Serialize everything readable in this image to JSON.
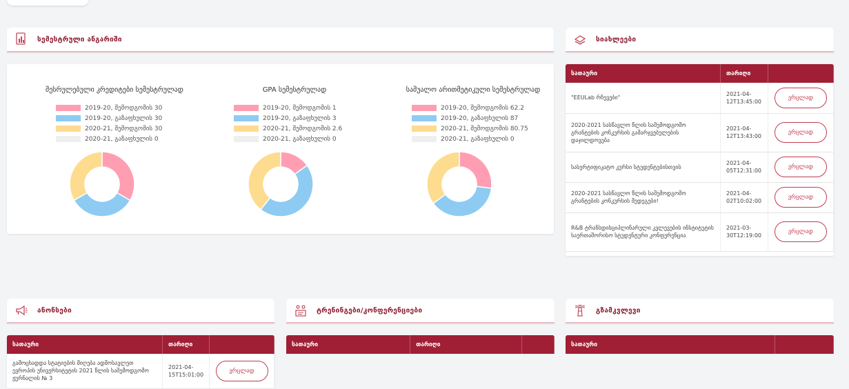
{
  "semester_report": {
    "title": "სემესტრული ანგარიში",
    "charts": [
      {
        "title": "შესრულებული კრედიტები სემესტრულად",
        "legend": [
          "2019-20, შემოდგომის 30",
          "2019-20, გაზაფხულის 30",
          "2020-21, შემოდგომის 30",
          "2020-21, გაზაფხულის 0"
        ]
      },
      {
        "title": "GPA სემესტრულად",
        "legend": [
          "2019-20, შემოდგომის 1",
          "2019-20, გაზაფხულის 3",
          "2020-21, შემოდგომის 2.6",
          "2020-21, გაზაფხულის 0"
        ]
      },
      {
        "title": "საშუალო არითმეტიკული სემესტრულად",
        "legend": [
          "2019-20, შემოდგომის 62.2",
          "2019-20, გაზაფხულის 87",
          "2020-21, შემოდგომის 80.75",
          "2020-21, გაზაფხულის 0"
        ]
      }
    ]
  },
  "chart_data": [
    {
      "type": "pie",
      "title": "შესრულებული კრედიტები სემესტრულად",
      "categories": [
        "2019-20, შემოდგომის",
        "2019-20, გაზაფხულის",
        "2020-21, შემოდგომის",
        "2020-21, გაზაფხულის"
      ],
      "values": [
        30,
        30,
        30,
        0
      ],
      "colors": [
        "#ff9eb2",
        "#8ecbf2",
        "#fddc8f",
        "#efefef"
      ],
      "legend_position": "top"
    },
    {
      "type": "pie",
      "title": "GPA სემესტრულად",
      "categories": [
        "2019-20, შემოდგომის",
        "2019-20, გაზაფხულის",
        "2020-21, შემოდგომის",
        "2020-21, გაზაფხულის"
      ],
      "values": [
        1,
        3,
        2.6,
        0
      ],
      "colors": [
        "#ff9eb2",
        "#8ecbf2",
        "#fddc8f",
        "#efefef"
      ],
      "legend_position": "top"
    },
    {
      "type": "pie",
      "title": "საშუალო არითმეტიკული სემესტრულად",
      "categories": [
        "2019-20, შემოდგომის",
        "2019-20, გაზაფხულის",
        "2020-21, შემოდგომის",
        "2020-21, გაზაფხულის"
      ],
      "values": [
        62.2,
        87,
        80.75,
        0
      ],
      "colors": [
        "#ff9eb2",
        "#8ecbf2",
        "#fddc8f",
        "#efefef"
      ],
      "legend_position": "top"
    }
  ],
  "news": {
    "title": "სიახლეები",
    "col_title": "სათაური",
    "col_date": "თარიღი",
    "button_label": "ვრცლად",
    "rows": [
      {
        "title": "\"EEULab რჩევები\"",
        "date": "2021-04-12T13:45:00"
      },
      {
        "title": "2020-2021 სასწავლო წლის საშემოდგომო გრანტების კონკურსის გამარჯვებულების დაჯილდოვება",
        "date": "2021-04-12T13:43:00"
      },
      {
        "title": "სასერტიფიკატო კურსი სტუდენტებისთვის",
        "date": "2021-04-05T12:31:00"
      },
      {
        "title": "2020-2021 სასწავლო წლის საშემოდგომო გრანტების კონკურსის შედეგები!",
        "date": "2021-04-02T10:02:00"
      },
      {
        "title": "R&B ტრანსდისციპლინარული კვლევების ინსტიტუტის საერთაშორისო სტუდენტური კონფერენცია",
        "date": "2021-03-30T12:19:00"
      }
    ]
  },
  "announcements": {
    "title": "ანონსები",
    "col_title": "სათაური",
    "col_date": "თარიღი",
    "button_label": "ვრცლად",
    "rows": [
      {
        "title": "გამოცხადდა სტატიების მიღება ადმოსავლეთ ევროპის უნივერსიტეტის 2021 წლის საშემოდგომო ჟურნალის № 3",
        "date": "2021-04-15T15:01:00"
      }
    ]
  },
  "trainings": {
    "title": "ტრენინგები/კონფერენციები",
    "col_title": "სათაური",
    "col_date": "თარიღი"
  },
  "guide": {
    "title": "გზამკვლევი",
    "col_title": "სათაური"
  }
}
